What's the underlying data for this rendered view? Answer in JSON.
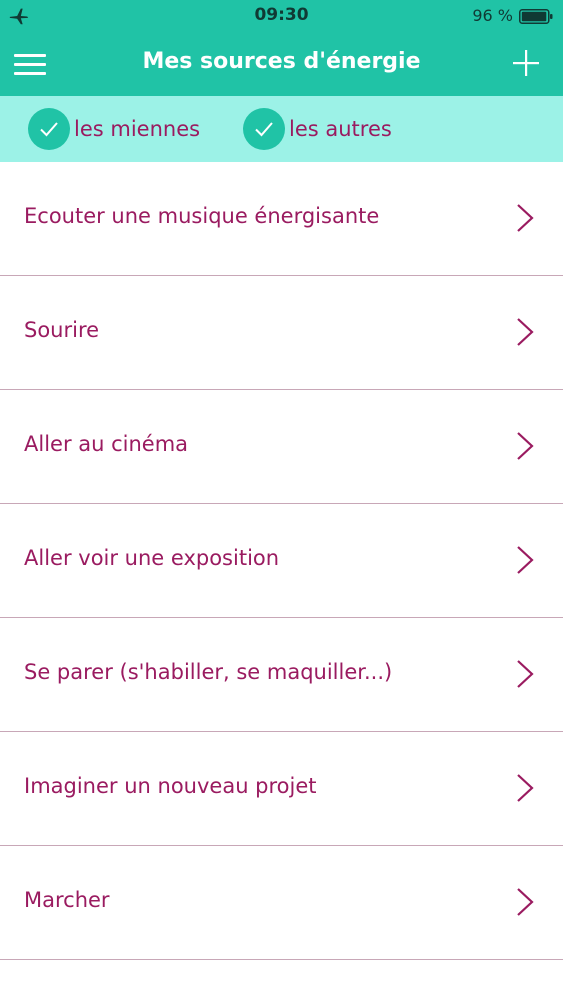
{
  "status_bar": {
    "time": "09:30",
    "battery": "96 %",
    "airplane_icon": "airplane-icon",
    "battery_icon": "battery-icon"
  },
  "nav": {
    "title": "Mes sources d'énergie",
    "menu_icon": "hamburger-menu-icon",
    "add_icon": "plus-icon"
  },
  "filters": [
    {
      "label": "les miennes",
      "checked": true
    },
    {
      "label": "les autres",
      "checked": true
    }
  ],
  "items": [
    {
      "label": "Ecouter une musique énergisante"
    },
    {
      "label": "Sourire"
    },
    {
      "label": "Aller au cinéma"
    },
    {
      "label": "Aller voir une exposition"
    },
    {
      "label": "Se parer (s'habiller, se maquiller...)"
    },
    {
      "label": "Imaginer un nouveau projet"
    },
    {
      "label": "Marcher"
    }
  ],
  "colors": {
    "header": "#20c3a6",
    "filter_bar": "#9cf2e7",
    "text": "#9a1b60",
    "divider": "#c8a7b7"
  }
}
